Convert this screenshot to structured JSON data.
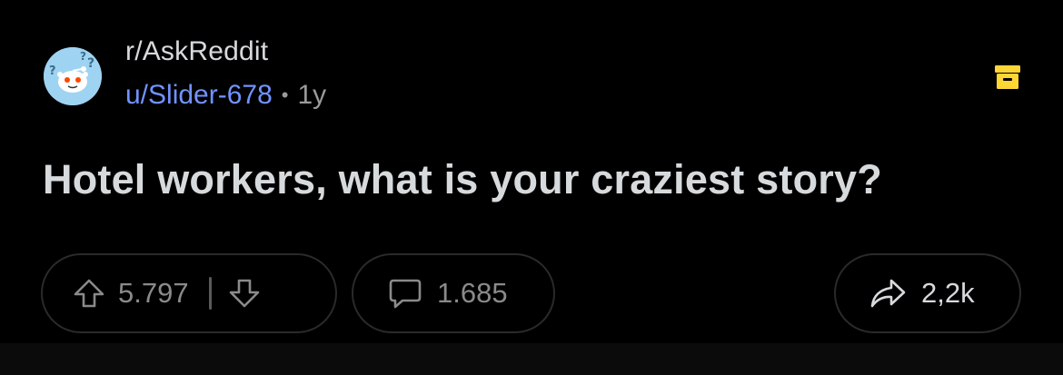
{
  "post": {
    "subreddit": "r/AskReddit",
    "author": "u/Slider-678",
    "separator": "•",
    "age": "1y",
    "title": "Hotel workers, what is your craziest story?",
    "votes": {
      "score": "5.797"
    },
    "comments": {
      "count": "1.685"
    },
    "share": {
      "count": "2,2k"
    }
  },
  "icons": {
    "avatar": "askreddit-snoo-icon",
    "archive": "archive-box-icon",
    "upvote": "upvote-arrow-icon",
    "downvote": "downvote-arrow-icon",
    "comment": "comment-bubble-icon",
    "share": "share-arrow-icon"
  },
  "colors": {
    "background": "#000000",
    "username": "#7193ff",
    "archive_icon": "#ffd635",
    "avatar_bg": "#9fd3f2"
  }
}
